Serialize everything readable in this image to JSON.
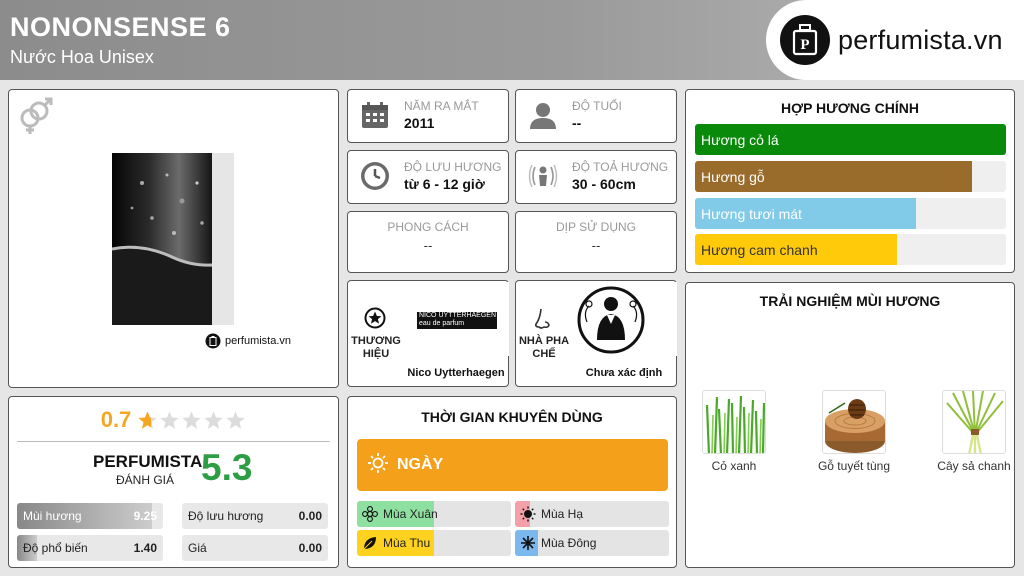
{
  "header": {
    "title": "NONONSENSE 6",
    "subtitle": "Nước Hoa Unisex",
    "brand_name": "perfumista.vn"
  },
  "product": {
    "gender_icon": "male-female-icon",
    "watermark": "perfumista.vn"
  },
  "rating": {
    "value": "0.7",
    "stars_filled": 0.7,
    "stars_total": 5,
    "pf_label": "PERFUMISTA",
    "pf_sub": "ĐÁNH GIÁ",
    "pf_score": "5.3",
    "stats": [
      {
        "label": "Mùi hương",
        "value": "9.25",
        "fill": 0.925
      },
      {
        "label": "Độ lưu hương",
        "value": "0.00",
        "fill": 0
      },
      {
        "label": "Độ phổ biến",
        "value": "1.40",
        "fill": 0.14
      },
      {
        "label": "Giá",
        "value": "0.00",
        "fill": 0
      }
    ]
  },
  "info": {
    "launch": {
      "label": "NĂM RA MẮT",
      "value": "2011",
      "icon": "calendar-icon"
    },
    "age": {
      "label": "ĐỘ TUỔI",
      "value": "--",
      "icon": "person-icon"
    },
    "longevity": {
      "label": "ĐỘ LƯU HƯƠNG",
      "value": "từ 6 - 12 giờ",
      "icon": "clock-icon"
    },
    "sillage": {
      "label": "ĐỘ TOẢ HƯƠNG",
      "value": "30 - 60cm",
      "icon": "sillage-icon"
    },
    "style": {
      "label": "PHONG CÁCH",
      "value": "--"
    },
    "occasion": {
      "label": "DỊP SỬ DỤNG",
      "value": "--"
    }
  },
  "brand": {
    "label_line1": "THƯƠNG",
    "label_line2": "HIỆU",
    "logo_line1": "NICO UYTTERHAEGEN",
    "logo_line2": "eau de parfum",
    "name": "Nico Uytterhaegen"
  },
  "perfumer": {
    "label_line1": "NHÀ PHA",
    "label_line2": "CHẾ",
    "name": "Chưa xác định"
  },
  "time": {
    "title": "THỜI GIAN KHUYÊN DÙNG",
    "day_label": "NGÀY",
    "seasons": [
      {
        "label": "Mùa Xuân",
        "fill": 0.5,
        "color": "#8ee0a0"
      },
      {
        "label": "Mùa Hạ",
        "fill": 0.1,
        "color": "#f4a0a8"
      },
      {
        "label": "Mùa Thu",
        "fill": 0.5,
        "color": "#ffd21f"
      },
      {
        "label": "Mùa Đông",
        "fill": 0.15,
        "color": "#7ab8ee"
      }
    ]
  },
  "accords": {
    "title": "HỢP HƯƠNG CHÍNH",
    "items": [
      {
        "label": "Hương cỏ lá",
        "fill": 1.0,
        "color": "#0a8a0a"
      },
      {
        "label": "Hương gỗ",
        "fill": 0.89,
        "color": "#9a6c2c"
      },
      {
        "label": "Hương tươi mát",
        "fill": 0.71,
        "color": "#82cbe8"
      },
      {
        "label": "Hương cam chanh",
        "fill": 0.65,
        "color": "#ffca0a"
      }
    ]
  },
  "notes": {
    "title": "TRẢI NGHIỆM MÙI HƯƠNG",
    "items": [
      {
        "name": "Cỏ xanh"
      },
      {
        "name": "Gỗ tuyết tùng"
      },
      {
        "name": "Cây sả chanh"
      }
    ]
  }
}
